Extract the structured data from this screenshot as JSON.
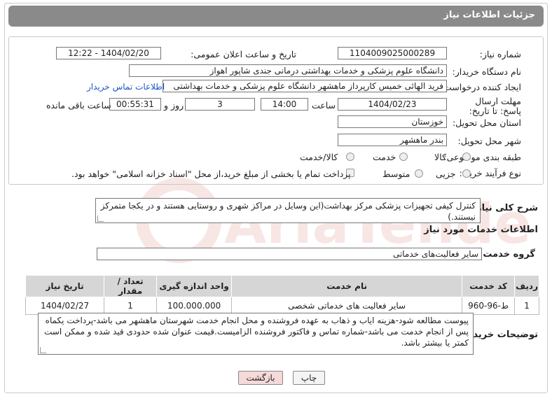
{
  "header": {
    "title": "جزئیات اطلاعات نیاز"
  },
  "fields": {
    "need_number_label": "شماره نیاز:",
    "need_number": "1104009025000289",
    "announce_label": "تاریخ و ساعت اعلان عمومی:",
    "announce_value": "1404/02/20 - 12:22",
    "buyer_org_label": "نام دستگاه خریدار:",
    "buyer_org": "دانشگاه علوم پزشکی و خدمات بهداشتی درمانی جندی شاپور اهواز",
    "creator_label": "ایجاد کننده درخواست:",
    "creator": "فرید الهائی خمیس کارپرداز ماهشهر دانشگاه علوم پزشکی و خدمات بهداشتی",
    "contact_link": "اطلاعات تماس خریدار",
    "deadline_label": "مهلت ارسال پاسخ: تا تاریخ:",
    "deadline_date": "1404/02/23",
    "time_label": "ساعت",
    "deadline_time": "14:00",
    "days_value": "3",
    "days_label": "روز و",
    "remaining_time": "00:55:31",
    "remaining_label": "ساعت باقی مانده",
    "province_label": "استان محل تحویل:",
    "province": "خوزستان",
    "city_label": "شهر محل تحویل:",
    "city": "بندر ماهشهر",
    "category_label": "طبقه بندی موضوعی:",
    "category_options": [
      "کالا",
      "خدمت",
      "کالا/خدمت"
    ],
    "process_label": "نوع فرآیند خرید :",
    "process_options": [
      "جزیی",
      "متوسط"
    ],
    "treasury_note": "پرداخت تمام یا بخشی از مبلغ خرید،از محل \"اسناد خزانه اسلامی\" خواهد بود."
  },
  "summary": {
    "label": "شرح کلی نیاز:",
    "text": "کنترل کیفی تجهیزات پزشکی مرکز بهداشت(این وسایل در مراکز شهری و روستایی هستند و در یکجا متمرکز نیستند.)"
  },
  "services": {
    "section_title": "اطلاعات خدمات مورد نیاز",
    "group_label": "گروه خدمت:",
    "group_value": "سایر فعالیت‌های خدماتی",
    "columns": [
      "ردیف",
      "کد خدمت",
      "نام خدمت",
      "واحد اندازه گیری",
      "تعداد / مقدار",
      "تاریخ نیاز"
    ],
    "rows": [
      [
        "1",
        "ط-96-960",
        "سایر فعالیت های خدماتی شخصی",
        "100.000.000",
        "1",
        "1404/02/27"
      ]
    ]
  },
  "buyer_notes": {
    "label": "توضیحات خریدار:",
    "text": "پیوست مطالعه شود-هزینه ایاب و ذهاب به عهده فروشنده و محل انجام خدمت شهرستان ماهشهر می باشد-پرداخت یکماه پس از انجام خدمت می باشد-شماره تماس و فاکتور فروشنده الزامیست.قیمت عنوان شده حدودی قید شده و ممکن است کمتر یا بیشتر باشد."
  },
  "buttons": {
    "print": "چاپ",
    "back": "بازگشت"
  },
  "colors": {
    "header_bg": "#8a8a8a",
    "link": "#1a56c8",
    "back_button_bg": "#f6d9d9",
    "watermark": "#c0392b"
  },
  "watermark_text": "AriaTender.neT"
}
